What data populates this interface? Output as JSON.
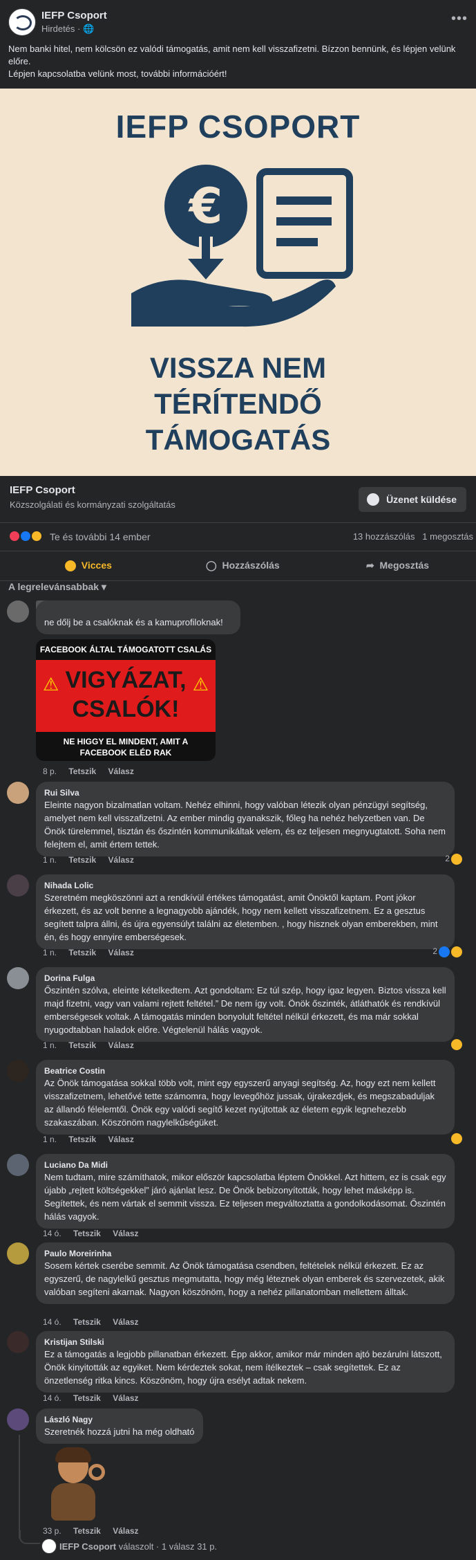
{
  "post": {
    "page_name": "IEFP Csoport",
    "sponsored": "Hirdetés · ",
    "more": "•••",
    "text_line1": "Nem banki hitel, nem kölcsön  ez valódi támogatás, amit nem kell visszafizetni. Bízzon bennünk, és lépjen velünk előre.",
    "text_line2": "Lépjen kapcsolatba velünk most, további információért!"
  },
  "ad": {
    "title": "IEFP CSOPORT",
    "line1": "VISSZA NEM",
    "line2": "TÉRÍTENDŐ",
    "line3": "TÁMOGATÁS",
    "currency": "€"
  },
  "cta": {
    "name": "IEFP Csoport",
    "category": "Közszolgálati és kormányzati szolgáltatás",
    "button": "Üzenet küldése"
  },
  "reactions": {
    "text": "Te és további 14 ember",
    "comments": "13 hozzászólás",
    "shares": "1 megosztás"
  },
  "actions": {
    "like": "Vicces",
    "comment": "Hozzászólás",
    "share": "Megosztás"
  },
  "sort_label": "A legrelevánsabbak",
  "warning_image": {
    "top": "FACEBOOK ÁLTAL TÁMOGATOTT CSALÁS",
    "line1": "VIGYÁZAT,",
    "line2": "CSALÓK!",
    "bottom1": "NE HIGGY EL MINDENT, AMIT A",
    "bottom2": "FACEBOOK ELÉD RAK"
  },
  "labels": {
    "like": "Tetszik",
    "reply": "Válasz"
  },
  "comments": [
    {
      "name": "",
      "text": "ne dőlj be a csalóknak és a kamuprofiloknak!",
      "time": "8 p.",
      "count": ""
    },
    {
      "name": "Rui Silva",
      "text": "Eleinte nagyon bizalmatlan voltam. Nehéz elhinni, hogy valóban létezik olyan pénzügyi segítség, amelyet nem kell visszafizetni. Az ember mindig gyanakszik, főleg ha nehéz helyzetben van. De Önök türelemmel, tisztán és őszintén kommunikáltak velem, és ez teljesen megnyugtatott. Soha nem felejtem el, amit értem tettek.",
      "time": "1 n.",
      "count": "2"
    },
    {
      "name": "Nihada Lolic",
      "text": "Szeretném megköszönni azt a rendkívül értékes támogatást, amit Önöktől kaptam. Pont jókor érkezett, és az volt benne a legnagyobb ajándék, hogy nem kellett visszafizetnem. Ez a gesztus segített talpra állni, és újra egyensúlyt találni az életemben. , hogy hisznek olyan emberekben, mint én, és hogy ennyire emberségesek.",
      "time": "1 n.",
      "count": "2"
    },
    {
      "name": "Dorina Fulga",
      "text": "Őszintén szólva, eleinte kételkedtem. Azt gondoltam: Ez túl szép, hogy igaz legyen. Biztos vissza kell majd fizetni, vagy van valami rejtett feltétel.” De nem így volt. Önök őszinték, átláthatók és rendkívül emberségesek voltak. A támogatás minden bonyolult feltétel nélkül érkezett, és ma már sokkal nyugodtabban haladok előre. Végtelenül hálás vagyok.",
      "time": "1 n.",
      "count": ""
    },
    {
      "name": "Beatrice Costin",
      "text": "Az Önök támogatása sokkal több volt, mint egy egyszerű anyagi segítség. Az, hogy ezt nem kellett visszafizetnem, lehetővé tette számomra, hogy levegőhöz jussak, újrakezdjek, és megszabaduljak az állandó félelemtől. Önök egy valódi segítő kezet nyújtottak az életem egyik legnehezebb szakaszában. Köszönöm nagylelkűségüket.",
      "time": "1 n.",
      "count": ""
    },
    {
      "name": "Luciano Da Midi",
      "text": "Nem tudtam, mire számíthatok, mikor először kapcsolatba léptem Önökkel. Azt hittem, ez is csak egy újabb „rejtett költségekkel” járó ajánlat lesz. De Önök bebizonyították, hogy lehet másképp is. Segítettek, és nem vártak el semmit vissza. Ez teljesen megváltoztatta a gondolkodásomat. Őszintén hálás vagyok.",
      "time": "14 ó.",
      "count": ""
    },
    {
      "name": "Paulo Moreirinha",
      "text": "Sosem kértek cserébe semmit. Az Önök támogatása csendben, feltételek nélkül érkezett. Ez az egyszerű, de nagylelkű gesztus megmutatta, hogy még léteznek olyan emberek és szervezetek, akik valóban segíteni akarnak. Nagyon köszönöm, hogy a nehéz pillanatomban mellettem álltak.",
      "time": "14 ó.",
      "count": ""
    },
    {
      "name": "Kristijan Stilski",
      "text": "Ez a támogatás a legjobb pillanatban érkezett. Épp akkor, amikor már minden ajtó bezárulni látszott, Önök kinyitották az egyiket. Nem kérdeztek sokat, nem ítélkeztek – csak segítettek. Ez az önzetlenség ritka kincs. Köszönöm, hogy újra esélyt adtak nekem.",
      "time": "14 ó.",
      "count": ""
    },
    {
      "name": "László Nagy",
      "text": "Szeretnék hozzá jutni ha még oldható",
      "time": "33 p.",
      "count": ""
    }
  ],
  "reply_summary": {
    "name": "IEFP Csoport",
    "text": "válaszolt · 1 válasz",
    "time": "31 p."
  },
  "colors": {
    "accent": "#f7b928",
    "brand": "#1f3f5d",
    "bg": "#242526",
    "bubble": "#3a3b3c"
  }
}
